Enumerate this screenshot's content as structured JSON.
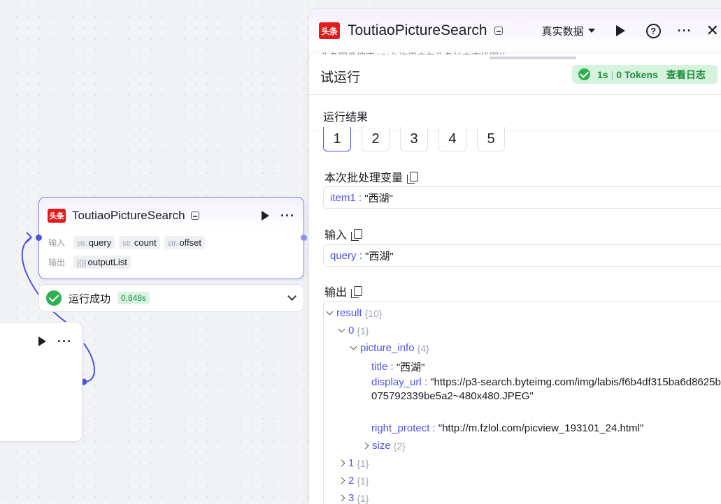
{
  "canvas": {
    "main_node": {
      "logo_text": "头条",
      "title": "ToutiaoPictureSearch",
      "input_label": "输入",
      "output_label": "输出",
      "inputs": [
        {
          "type": "str.",
          "name": "query"
        },
        {
          "type": "str.",
          "name": "count"
        },
        {
          "type": "str.",
          "name": "offset"
        }
      ],
      "output": {
        "type": "[{}]",
        "name": "outputList"
      }
    },
    "run_status": {
      "text": "运行成功",
      "time": "0.848s"
    }
  },
  "panel": {
    "logo_text": "头条",
    "title": "ToutiaoPictureSearch",
    "data_mode": "真实数据",
    "description": "头条图像搜索API允许用户在头条站内查找图片",
    "test_run_title": "试运行",
    "result_badge": {
      "stats": "1s",
      "tokens": "0 Tokens",
      "log_link": "查看日志"
    },
    "results_title": "运行结果",
    "batch_tabs": [
      "1",
      "2",
      "3",
      "4",
      "5"
    ],
    "batch_var": {
      "title": "本次批处理变量",
      "key": "item1 :",
      "value": "\"西湖\""
    },
    "input": {
      "title": "输入",
      "key": "query :",
      "value": "\"西湖\""
    },
    "output": {
      "title": "输出",
      "root": {
        "key": "result",
        "count": "{10}"
      },
      "item0": {
        "key": "0",
        "count": "{1}"
      },
      "picture_info": {
        "key": "picture_info",
        "count": "{4}"
      },
      "title_field": {
        "key": "title :",
        "value": "\"西湖\""
      },
      "display_url": {
        "key": "display_url :",
        "value": "\"https://p3-search.byteimg.com/img/labis/f6b4df315ba6d8625b075792339be5a2~480x480.JPEG\""
      },
      "right_protect": {
        "key": "right_protect :",
        "value": "\"http://m.fzlol.com/picview_193101_24.html\""
      },
      "size": {
        "key": "size",
        "count": "{2}"
      },
      "collapsed_items": [
        {
          "key": "1",
          "count": "{1}"
        },
        {
          "key": "2",
          "count": "{1}"
        },
        {
          "key": "3",
          "count": "{1}"
        }
      ]
    }
  },
  "colors": {
    "accent": "#4d53e8",
    "success": "#2fb050",
    "brand_red": "#e21b1b"
  }
}
